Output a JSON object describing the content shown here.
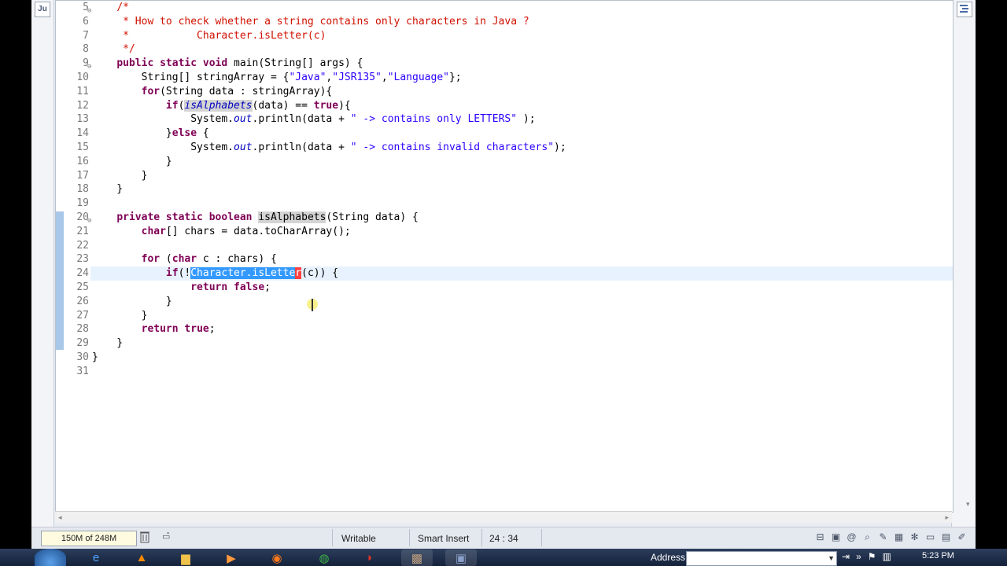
{
  "editor": {
    "lines": [
      {
        "n": "5",
        "fold": "⊖",
        "html_parts": [
          {
            "t": "    ",
            "c": ""
          },
          {
            "t": "/*",
            "c": "cm"
          }
        ]
      },
      {
        "n": "6",
        "fold": "",
        "html_parts": [
          {
            "t": "     * How to check whether a string contains only characters in Java ?",
            "c": "cm"
          }
        ]
      },
      {
        "n": "7",
        "fold": "",
        "html_parts": [
          {
            "t": "     *           Character.isLetter(c)",
            "c": "cm"
          }
        ]
      },
      {
        "n": "8",
        "fold": "",
        "html_parts": [
          {
            "t": "     */",
            "c": "cm"
          }
        ]
      },
      {
        "n": "9",
        "fold": "⊖",
        "html_parts": [
          {
            "t": "    ",
            "c": ""
          },
          {
            "t": "public static void",
            "c": "kw"
          },
          {
            "t": " main(String[] args) {",
            "c": ""
          }
        ]
      },
      {
        "n": "10",
        "fold": "",
        "html_parts": [
          {
            "t": "        String[] stringArray = {",
            "c": ""
          },
          {
            "t": "\"Java\"",
            "c": "st"
          },
          {
            "t": ",",
            "c": ""
          },
          {
            "t": "\"JSR135\"",
            "c": "st"
          },
          {
            "t": ",",
            "c": ""
          },
          {
            "t": "\"Language\"",
            "c": "st"
          },
          {
            "t": "};",
            "c": ""
          }
        ]
      },
      {
        "n": "11",
        "fold": "",
        "html_parts": [
          {
            "t": "        ",
            "c": ""
          },
          {
            "t": "for",
            "c": "kw"
          },
          {
            "t": "(String data : stringArray){",
            "c": ""
          }
        ]
      },
      {
        "n": "12",
        "fold": "",
        "html_parts": [
          {
            "t": "            ",
            "c": ""
          },
          {
            "t": "if",
            "c": "kw"
          },
          {
            "t": "(",
            "c": ""
          },
          {
            "t": "isAlphabets",
            "c": "occ it"
          },
          {
            "t": "(data) == ",
            "c": ""
          },
          {
            "t": "true",
            "c": "kw"
          },
          {
            "t": "){",
            "c": ""
          }
        ]
      },
      {
        "n": "13",
        "fold": "",
        "html_parts": [
          {
            "t": "                System.",
            "c": ""
          },
          {
            "t": "out",
            "c": "it"
          },
          {
            "t": ".println(data + ",
            "c": ""
          },
          {
            "t": "\" -> contains only LETTERS\"",
            "c": "st"
          },
          {
            "t": " );",
            "c": ""
          }
        ]
      },
      {
        "n": "14",
        "fold": "",
        "html_parts": [
          {
            "t": "            }",
            "c": ""
          },
          {
            "t": "else",
            "c": "kw"
          },
          {
            "t": " {",
            "c": ""
          }
        ]
      },
      {
        "n": "15",
        "fold": "",
        "html_parts": [
          {
            "t": "                System.",
            "c": ""
          },
          {
            "t": "out",
            "c": "it"
          },
          {
            "t": ".println(data + ",
            "c": ""
          },
          {
            "t": "\" -> contains invalid characters\"",
            "c": "st"
          },
          {
            "t": ");",
            "c": ""
          }
        ]
      },
      {
        "n": "16",
        "fold": "",
        "html_parts": [
          {
            "t": "            }",
            "c": ""
          }
        ]
      },
      {
        "n": "17",
        "fold": "",
        "html_parts": [
          {
            "t": "        }",
            "c": ""
          }
        ]
      },
      {
        "n": "18",
        "fold": "",
        "html_parts": [
          {
            "t": "    }",
            "c": ""
          }
        ]
      },
      {
        "n": "19",
        "fold": "",
        "html_parts": [
          {
            "t": "",
            "c": ""
          }
        ]
      },
      {
        "n": "20",
        "fold": "⊖",
        "html_parts": [
          {
            "t": "    ",
            "c": ""
          },
          {
            "t": "private static boolean",
            "c": "kw"
          },
          {
            "t": " ",
            "c": ""
          },
          {
            "t": "isAlphabets",
            "c": "occ"
          },
          {
            "t": "(String data) {",
            "c": ""
          }
        ]
      },
      {
        "n": "21",
        "fold": "",
        "html_parts": [
          {
            "t": "        ",
            "c": ""
          },
          {
            "t": "char",
            "c": "kw"
          },
          {
            "t": "[] chars = data.toCharArray();",
            "c": ""
          }
        ]
      },
      {
        "n": "22",
        "fold": "",
        "html_parts": [
          {
            "t": "",
            "c": ""
          }
        ]
      },
      {
        "n": "23",
        "fold": "",
        "html_parts": [
          {
            "t": "        ",
            "c": ""
          },
          {
            "t": "for",
            "c": "kw"
          },
          {
            "t": " (",
            "c": ""
          },
          {
            "t": "char",
            "c": "kw"
          },
          {
            "t": " c : chars) {",
            "c": ""
          }
        ]
      },
      {
        "n": "24",
        "fold": "",
        "current": true,
        "html_parts": [
          {
            "t": "            ",
            "c": ""
          },
          {
            "t": "if",
            "c": "kw"
          },
          {
            "t": "(!",
            "c": ""
          },
          {
            "t": "Character.isLette",
            "c": "sel"
          },
          {
            "t": "r",
            "c": "cursor-mark"
          },
          {
            "t": "(c)) {",
            "c": ""
          }
        ]
      },
      {
        "n": "25",
        "fold": "",
        "html_parts": [
          {
            "t": "                ",
            "c": ""
          },
          {
            "t": "return false",
            "c": "kw"
          },
          {
            "t": ";",
            "c": ""
          }
        ]
      },
      {
        "n": "26",
        "fold": "",
        "html_parts": [
          {
            "t": "            }",
            "c": ""
          }
        ]
      },
      {
        "n": "27",
        "fold": "",
        "html_parts": [
          {
            "t": "        }",
            "c": ""
          }
        ]
      },
      {
        "n": "28",
        "fold": "",
        "html_parts": [
          {
            "t": "        ",
            "c": ""
          },
          {
            "t": "return true",
            "c": "kw"
          },
          {
            "t": ";",
            "c": ""
          }
        ]
      },
      {
        "n": "29",
        "fold": "",
        "html_parts": [
          {
            "t": "    }",
            "c": ""
          }
        ]
      },
      {
        "n": "30",
        "fold": "",
        "html_parts": [
          {
            "t": "}",
            "c": ""
          }
        ]
      },
      {
        "n": "31",
        "fold": "",
        "html_parts": [
          {
            "t": "",
            "c": ""
          }
        ]
      }
    ]
  },
  "left_strip": {
    "junit_icon": "Ju"
  },
  "status": {
    "heap": "150M of 248M",
    "writable": "Writable",
    "insert_mode": "Smart Insert",
    "position": "24 : 34"
  },
  "taskbar": {
    "address_label": "Address",
    "clock": "5:23 PM",
    "apps": [
      "start-orb",
      "ie-icon",
      "vlc-icon",
      "folder-icon",
      "media-player-icon",
      "firefox-icon",
      "chrome-icon",
      "acrobat-icon",
      "app-icon",
      "save-icon"
    ]
  },
  "colors": {
    "keyword": "#7f0055",
    "comment": "#d01000",
    "string": "#2a00ff",
    "selection": "#3399ff",
    "current_line": "#e8f2fe"
  }
}
